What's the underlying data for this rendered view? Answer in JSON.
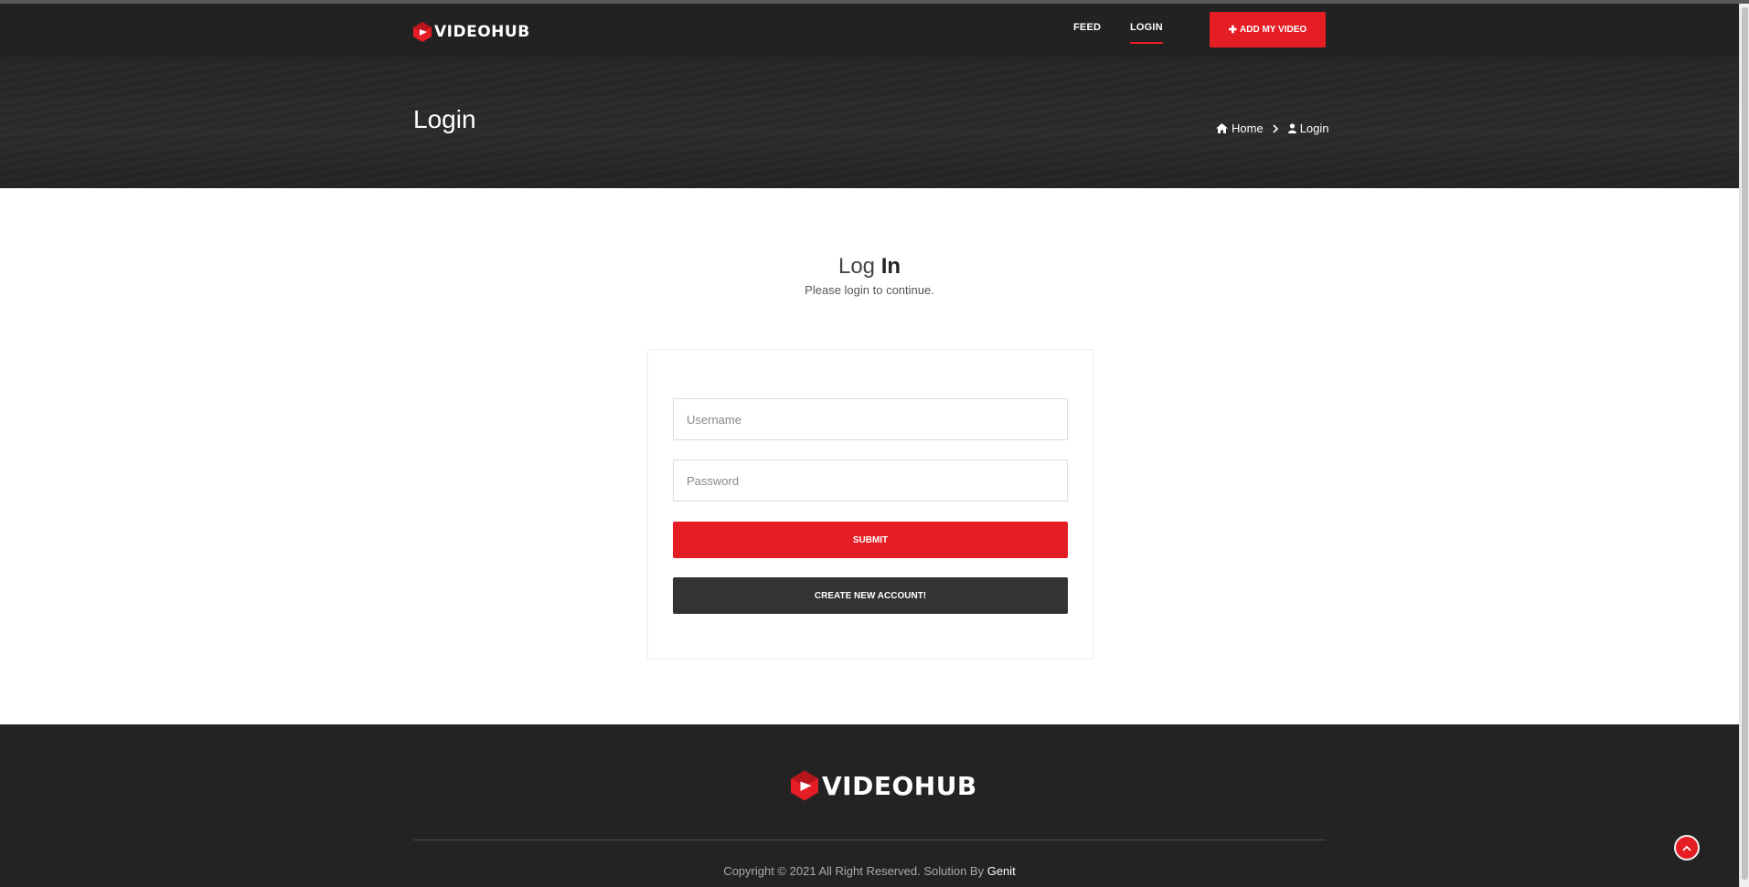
{
  "brand": {
    "name": "VIDEOHUB",
    "accent_color": "#e51e25",
    "dark_color": "#222222"
  },
  "nav": {
    "items": [
      {
        "label": "FEED"
      },
      {
        "label": "LOGIN"
      }
    ],
    "active_item": "LOGIN",
    "add_video_button": "ADD MY VIDEO"
  },
  "banner": {
    "title": "Login",
    "breadcrumb": [
      {
        "label": "Home",
        "icon": "home-icon"
      },
      {
        "label": "Login",
        "icon": "user-icon"
      }
    ]
  },
  "login": {
    "title_light": "Log",
    "title_bold": "In",
    "subtitle": "Please login to continue.",
    "username_placeholder": "Username",
    "password_placeholder": "Password",
    "submit_label": "SUBMIT",
    "create_account_label": "CREATE NEW ACCOUNT!"
  },
  "footer": {
    "copyright": "Copyright © 2021 All Right Reserved. Solution By",
    "solution_by": "Genit"
  }
}
